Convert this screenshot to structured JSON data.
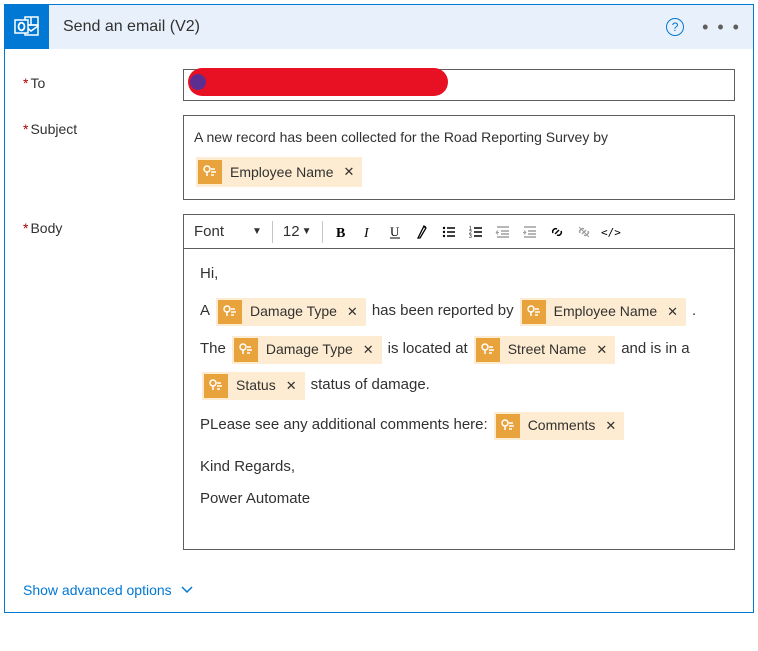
{
  "header": {
    "title": "Send an email (V2)",
    "help": "?",
    "more": "• • •"
  },
  "fields": {
    "to_label": "To",
    "subject_label": "Subject",
    "subject_text": "A new record has been collected for the Road Reporting Survey by",
    "body_label": "Body"
  },
  "toolbar": {
    "font_label": "Font",
    "font_size": "12"
  },
  "tokens": {
    "employee_name": "Employee Name",
    "damage_type": "Damage Type",
    "street_name": "Street Name",
    "status": "Status",
    "comments": "Comments"
  },
  "body": {
    "greeting": "Hi,",
    "l1a": "A",
    "l1b": "has been reported by",
    "l1c": ".",
    "l2a": "The",
    "l2b": "is located at",
    "l2c": "and is in a",
    "l2d": "status of damage.",
    "l3a": "PLease see any additional comments here:",
    "sig1": "Kind Regards,",
    "sig2": "Power Automate"
  },
  "footer": {
    "advanced": "Show advanced options"
  }
}
